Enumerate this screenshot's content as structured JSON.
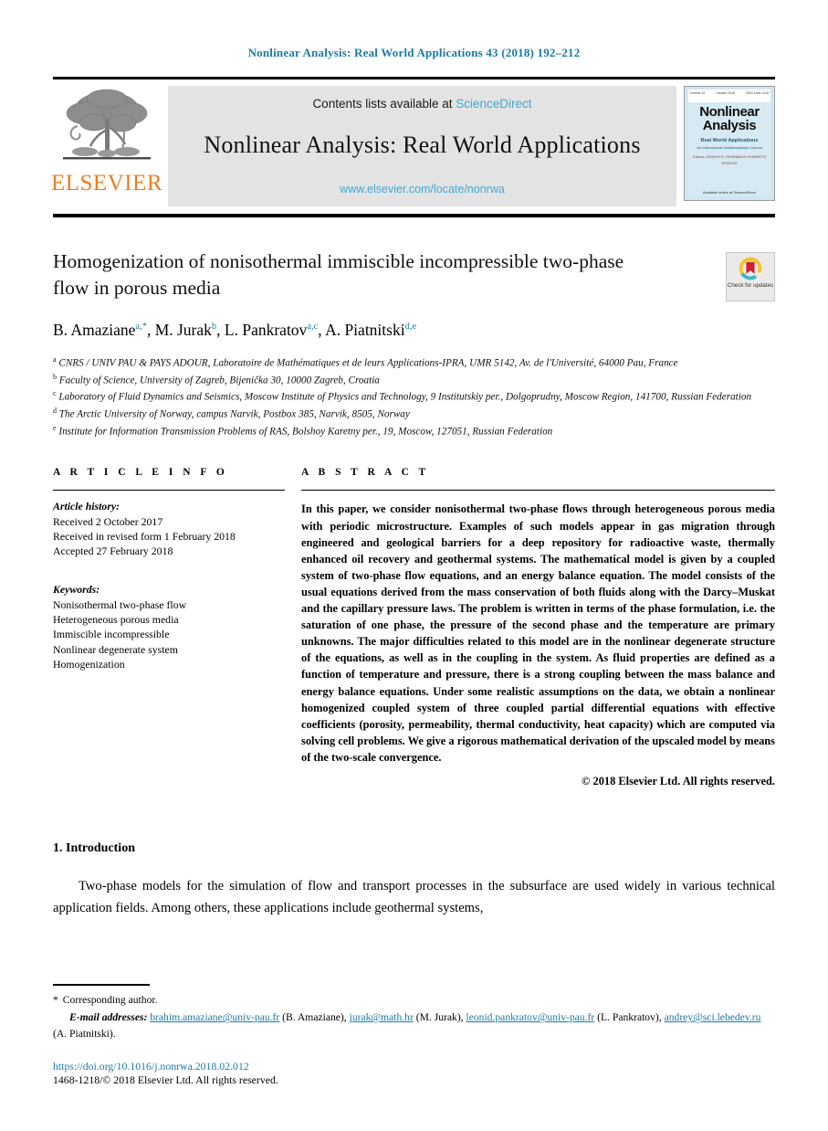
{
  "running_head": "Nonlinear Analysis: Real World Applications 43 (2018) 192–212",
  "masthead": {
    "contents_prefix": "Contents lists available at ",
    "sciencedirect_link": "ScienceDirect",
    "journal_name": "Nonlinear Analysis: Real World Applications",
    "journal_url": "www.elsevier.com/locate/nonrwa",
    "publisher_wordmark": "ELSEVIER",
    "cover": {
      "title_line1": "Nonlinear",
      "title_line2": "Analysis",
      "subtitle": "Real World Applications",
      "subtitle2": "An International Multidisciplinary Journal",
      "editors": "Editors\nJOSEPH D. FEHRIBACH\nROBERTO SPIGLER",
      "footer": "Available online at\nScienceDirect",
      "bar_left": "Volume 43",
      "bar_mid": "October 2018",
      "bar_right": "ISSN 1468-1218"
    }
  },
  "article": {
    "title": "Homogenization of nonisothermal immiscible incompressible two-phase flow in porous media",
    "authors": [
      {
        "name": "B. Amaziane",
        "sups": "a,*"
      },
      {
        "name": "M. Jurak",
        "sups": "b"
      },
      {
        "name": "L. Pankratov",
        "sups": "a,c"
      },
      {
        "name": "A. Piatnitski",
        "sups": "d,e"
      }
    ],
    "crossmark_label": "Check for\nupdates",
    "affiliations": [
      {
        "mark": "a",
        "text": "CNRS / UNIV PAU & PAYS ADOUR, Laboratoire de Mathématiques et de leurs Applications-IPRA, UMR 5142, Av. de l'Université, 64000 Pau, France"
      },
      {
        "mark": "b",
        "text": "Faculty of Science, University of Zagreb, Bijenička 30, 10000 Zagreb, Croatia"
      },
      {
        "mark": "c",
        "text": "Laboratory of Fluid Dynamics and Seismics, Moscow Institute of Physics and Technology, 9 Institutskiy per., Dolgoprudny, Moscow Region, 141700, Russian Federation"
      },
      {
        "mark": "d",
        "text": "The Arctic University of Norway, campus Narvik, Postbox 385, Narvik, 8505, Norway"
      },
      {
        "mark": "e",
        "text": "Institute for Information Transmission Problems of RAS, Bolshoy Karetny per., 19, Moscow, 127051, Russian Federation"
      }
    ]
  },
  "article_info": {
    "heading": "A R T I C L E   I N F O",
    "history_label": "Article history:",
    "history": [
      "Received 2 October 2017",
      "Received in revised form 1 February 2018",
      "Accepted 27 February 2018"
    ],
    "keywords_label": "Keywords:",
    "keywords": [
      "Nonisothermal two-phase flow",
      "Heterogeneous porous media",
      "Immiscible incompressible",
      "Nonlinear degenerate system",
      "Homogenization"
    ]
  },
  "abstract": {
    "heading": "A B S T R A C T",
    "text": "In this paper, we consider nonisothermal two-phase flows through heterogeneous porous media with periodic microstructure. Examples of such models appear in gas migration through engineered and geological barriers for a deep repository for radioactive waste, thermally enhanced oil recovery and geothermal systems. The mathematical model is given by a coupled system of two-phase flow equations, and an energy balance equation. The model consists of the usual equations derived from the mass conservation of both fluids along with the Darcy–Muskat and the capillary pressure laws. The problem is written in terms of the phase formulation, i.e. the saturation of one phase, the pressure of the second phase and the temperature are primary unknowns. The major difficulties related to this model are in the nonlinear degenerate structure of the equations, as well as in the coupling in the system. As fluid properties are defined as a function of temperature and pressure, there is a strong coupling between the mass balance and energy balance equations. Under some realistic assumptions on the data, we obtain a nonlinear homogenized coupled system of three coupled partial differential equations with effective coefficients (porosity, permeability, thermal conductivity, heat capacity) which are computed via solving cell problems. We give a rigorous mathematical derivation of the upscaled model by means of the two-scale convergence.",
    "copyright": "© 2018 Elsevier Ltd. All rights reserved."
  },
  "introduction": {
    "heading": "1. Introduction",
    "paragraph": "Two-phase models for the simulation of flow and transport processes in the subsurface are used widely in various technical application fields. Among others, these applications include geothermal systems,"
  },
  "footnotes": {
    "corresponding_mark": "*",
    "corresponding_text": "Corresponding author.",
    "emails_label": "E-mail addresses:",
    "emails": [
      {
        "address": "brahim.amaziane@univ-pau.fr",
        "owner": "(B. Amaziane),"
      },
      {
        "address": "jurak@math.hr",
        "owner": "(M. Jurak),"
      },
      {
        "address": "leonid.pankratov@univ-pau.fr",
        "owner": "(L. Pankratov),"
      },
      {
        "address": "andrey@sci.lebedev.ru",
        "owner": "(A. Piatnitski)."
      }
    ],
    "doi": "https://doi.org/10.1016/j.nonrwa.2018.02.012",
    "issn_line": "1468-1218/© 2018 Elsevier Ltd. All rights reserved."
  },
  "colors": {
    "link": "#1a7aa8",
    "sciencedirect": "#3fa9d4",
    "elsevier_orange": "#F07C1E",
    "masthead_bg": "#e3e3e3"
  }
}
